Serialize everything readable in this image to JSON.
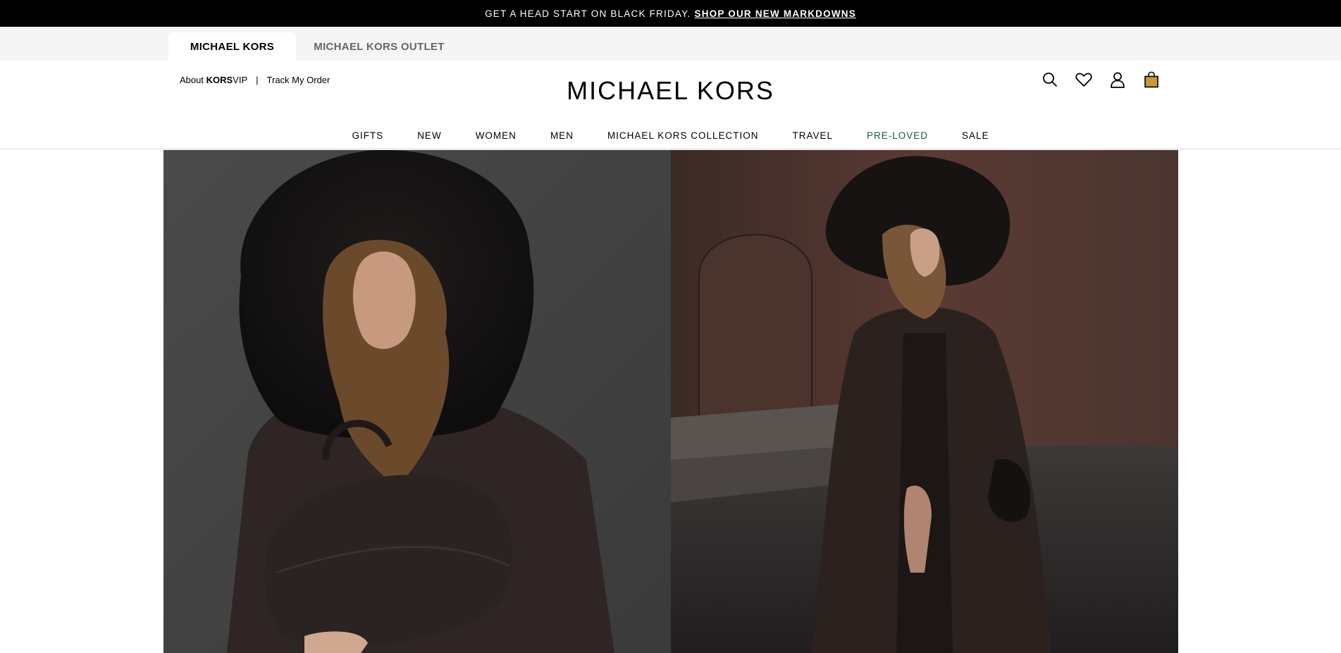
{
  "promo": {
    "text": "GET A HEAD START ON BLACK FRIDAY.",
    "link": "SHOP OUR NEW MARKDOWNS"
  },
  "site_tabs": [
    {
      "label": "MICHAEL KORS",
      "active": true
    },
    {
      "label": "MICHAEL KORS OUTLET",
      "active": false
    }
  ],
  "utility": {
    "about_prefix": "About",
    "about_kors": "KORS",
    "about_vip": "VIP",
    "separator": "|",
    "track_order": "Track My Order"
  },
  "logo": "MICHAEL KORS",
  "header_icons": [
    "search-icon",
    "heart-icon",
    "account-icon",
    "bag-icon"
  ],
  "nav": [
    {
      "label": "GIFTS"
    },
    {
      "label": "NEW"
    },
    {
      "label": "WOMEN"
    },
    {
      "label": "MEN"
    },
    {
      "label": "MICHAEL KORS COLLECTION"
    },
    {
      "label": "TRAVEL"
    },
    {
      "label": "PRE-LOVED",
      "color": "#0d5e3b"
    },
    {
      "label": "SALE"
    }
  ],
  "colors": {
    "promo_bg": "#000000",
    "tab_bar_bg": "#f5f5f5",
    "pre_loved": "#0d5e3b",
    "bag_icon": "#c99a3a"
  }
}
